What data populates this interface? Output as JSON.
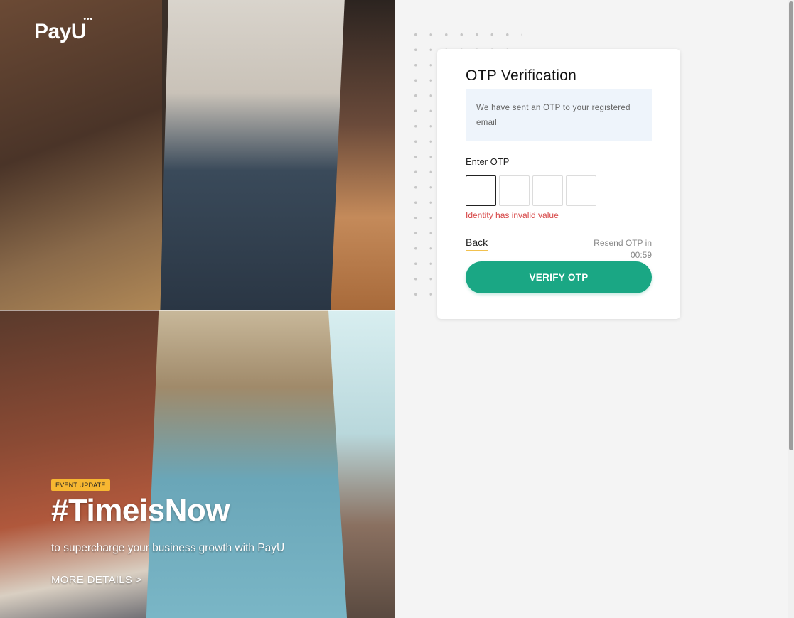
{
  "brand": {
    "logo_text": "PayU",
    "logo_dots": "•••"
  },
  "hero": {
    "event_badge": "EVENT UPDATE",
    "headline": "#TimeisNow",
    "subline": "to supercharge your business growth with PayU",
    "more_link": "MORE DETAILS >"
  },
  "otp_card": {
    "title": "OTP Verification",
    "info_message": "We have sent an OTP to your registered email",
    "input_label": "Enter OTP",
    "digits": [
      "",
      "",
      "",
      ""
    ],
    "error_message": "Identity has invalid value",
    "back_label": "Back",
    "resend_label": "Resend OTP in",
    "resend_timer": "00:59",
    "verify_button": "VERIFY OTP"
  },
  "colors": {
    "accent": "#1aa784",
    "badge": "#f7b731",
    "error": "#d64545",
    "info_bg": "#eef4fb",
    "back_underline": "#f2c14e"
  },
  "icons": {
    "scroll": "vertical-scrollbar"
  }
}
